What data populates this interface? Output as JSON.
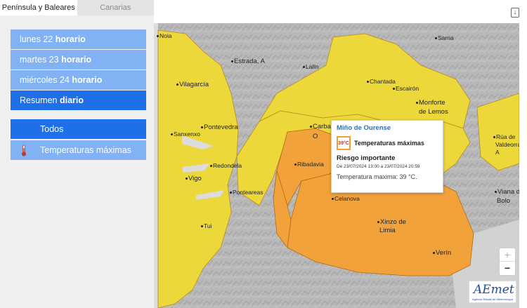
{
  "tabs": [
    {
      "label": "Península y Baleares",
      "active": true
    },
    {
      "label": "Canarias",
      "active": false
    }
  ],
  "days": [
    {
      "day": "lunes 22",
      "suffix": "horario",
      "selected": false
    },
    {
      "day": "martes 23",
      "suffix": "horario",
      "selected": false
    },
    {
      "day": "miércoles 24",
      "suffix": "horario",
      "selected": false
    },
    {
      "day": "Resumen",
      "suffix": "diario",
      "selected": true
    }
  ],
  "filters": {
    "all": "Todos",
    "temp": "Temperaturas máximas"
  },
  "map_labels": {
    "noia": "Noia",
    "estrada": "Estrada, A",
    "lalin": "Lalín",
    "sarria": "Sarria",
    "vilagarcia": "Vilagarcía",
    "chantada": "Chantada",
    "escairon": "Escairón",
    "monforte": "Monforte",
    "monforte2": "de Lemos",
    "carballino": "Carbal",
    "carballino2": "O",
    "sanxenxo": "Sanxenxo",
    "pontevedra": "Pontevedra",
    "redondela": "Redondela",
    "vigo": "Vigo",
    "ponteareas": "Ponteareas",
    "ribadavia": "Ribadavia",
    "celanova": "Celanova",
    "tui": "Tui",
    "xinzo": "Xinzo de",
    "xinzo2": "Limia",
    "verin": "Verín",
    "rua": "Rúa de",
    "rua2": "Valdeorras",
    "rua3": "A",
    "viana": "Viana d",
    "viana2": "Bolo"
  },
  "popup": {
    "zone": "Miño de Ourense",
    "type": "Temperaturas máximas",
    "icon_text": "39°C",
    "level": "Riesgo importante",
    "dates": "De 23/07/2024 13:00 a 23/07/2024 20:59",
    "value": "Temperatura maxima: 39 °C."
  },
  "zoom": {
    "in": "+",
    "out": "−"
  },
  "logo": {
    "name": "AEmet",
    "sub": "Agencia Estatal de Meteorología"
  },
  "colors": {
    "yellow": "#ecd83a",
    "orange": "#f2a23b",
    "terrain": "#b5b5b5",
    "day_light": "#82b2f4",
    "day_selected": "#1e6fe8"
  }
}
